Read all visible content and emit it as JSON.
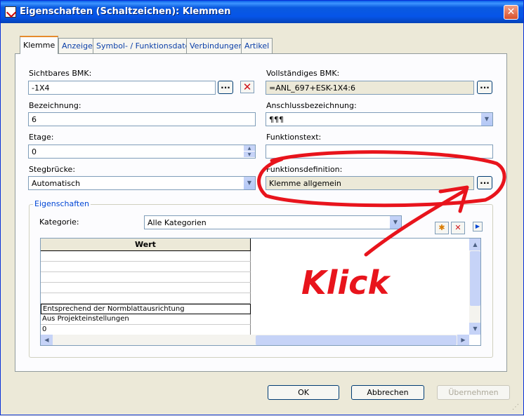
{
  "window": {
    "title": "Eigenschaften (Schaltzeichen): Klemmen",
    "close_label": "✕"
  },
  "tabs": [
    {
      "label": "Klemme",
      "active": true
    },
    {
      "label": "Anzeige",
      "active": false
    },
    {
      "label": "Symbol- / Funktionsdaten",
      "active": false
    },
    {
      "label": "Verbindungen",
      "active": false
    },
    {
      "label": "Artikel",
      "active": false
    }
  ],
  "fields": {
    "sichtbares_bmk": {
      "label": "Sichtbares BMK:",
      "value": "-1X4"
    },
    "vollstaendiges_bmk": {
      "label": "Vollständiges BMK:",
      "value": "=ANL_697+ESK-1X4:6"
    },
    "bezeichnung": {
      "label": "Bezeichnung:",
      "value": "6"
    },
    "anschlussbezeichnung": {
      "label": "Anschlussbezeichnung:",
      "value": "¶¶¶"
    },
    "etage": {
      "label": "Etage:",
      "value": "0"
    },
    "funktionstext": {
      "label": "Funktionstext:",
      "value": ""
    },
    "stegbruecke": {
      "label": "Stegbrücke:",
      "value": "Automatisch"
    },
    "funktionsdefinition": {
      "label": "Funktionsdefinition:",
      "value": "Klemme allgemein"
    }
  },
  "dots_label": "...",
  "delete_label": "✕",
  "properties_group": {
    "title": "Eigenschaften",
    "kategorie_label": "Kategorie:",
    "kategorie_value": "Alle Kategorien",
    "new_icon": "✱",
    "delete_icon": "✕",
    "expand_icon": "▶",
    "grid": {
      "column_header": "Wert",
      "rows": [
        "",
        "",
        "",
        "",
        "",
        "Entsprechend der Normblattausrichtung",
        "Aus Projekteinstellungen",
        "0"
      ]
    }
  },
  "buttons": {
    "ok": "OK",
    "cancel": "Abbrechen",
    "apply": "Übernehmen"
  },
  "annotation": {
    "text": "Klick",
    "color": "#e8141c"
  },
  "icons": {
    "dropdown": "▼",
    "spin_up": "▲",
    "spin_down": "▼",
    "scroll_up": "▲",
    "scroll_down": "▼",
    "scroll_left": "◀",
    "scroll_right": "▶",
    "grip": "⋰"
  }
}
